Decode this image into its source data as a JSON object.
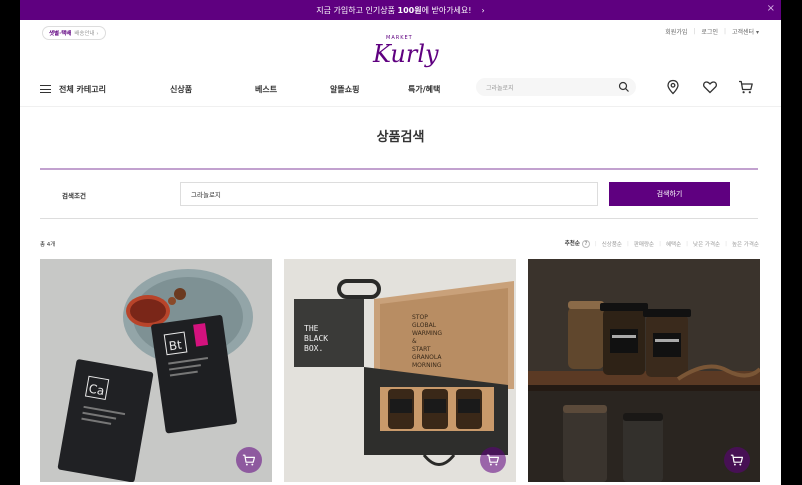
{
  "banner": {
    "text_before": "지금 가입하고 인기상품 ",
    "text_bold": "100원",
    "text_after": "에 받아가세요!",
    "arrow": "›",
    "close": "×"
  },
  "header": {
    "badge_accent": "샛별·택배",
    "badge_text": "배송안내 ›",
    "signup": "회원가입",
    "login": "로그인",
    "customer_center": "고객센터 ▾",
    "logo_market": "MARKET",
    "logo_text": "Kurly"
  },
  "nav": {
    "all_categories": "전체 카테고리",
    "items": [
      "신상품",
      "베스트",
      "알뜰쇼핑",
      "특가/혜택"
    ],
    "search_value": "그라놀로지"
  },
  "page_title": "상품검색",
  "search_condition": {
    "label": "검색조건",
    "value": "그라놀로지",
    "button": "검색하기"
  },
  "results": {
    "total": "총 4개",
    "sort_options": [
      "추천순",
      "신상품순",
      "판매량순",
      "혜택순",
      "낮은 가격순",
      "높은 가격순"
    ],
    "active_sort": "추천순"
  },
  "products": [
    {
      "name": "product-1",
      "box_line1": "THE",
      "box_line2": "BLACK",
      "box_line3": "BOX.",
      "pouch1_label": "Bt",
      "pouch2_label": "Ca"
    },
    {
      "name": "product-2",
      "box_line1": "THE",
      "box_line2": "BLACK",
      "box_line3": "BOX.",
      "lid_text_1": "STOP",
      "lid_text_2": "GLOBAL",
      "lid_text_3": "WARMING",
      "lid_text_4": "&",
      "lid_text_5": "START",
      "lid_text_6": "GRANOLA",
      "lid_text_7": "MORNING"
    },
    {
      "name": "product-3"
    }
  ],
  "colors": {
    "brand": "#5f0080",
    "brand_light": "#c2a1cf"
  }
}
